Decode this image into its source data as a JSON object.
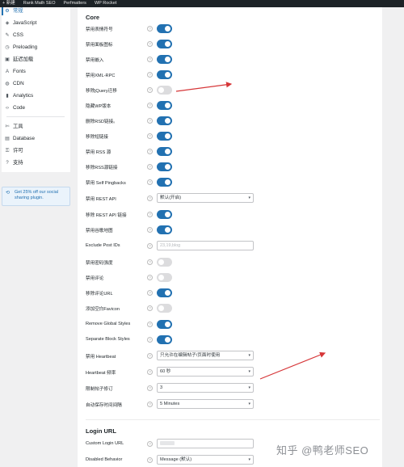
{
  "admin_bar": {
    "items": [
      "+ 新建",
      "Rank Math SEO",
      "Perfmatters",
      "WP Rocket"
    ]
  },
  "sidebar": {
    "items": [
      {
        "label": "常规",
        "icon": "gear-icon",
        "glyph": "⚙",
        "active": true
      },
      {
        "label": "JavaScript",
        "icon": "code-icon",
        "glyph": "◈",
        "active": false
      },
      {
        "label": "CSS",
        "icon": "brush-icon",
        "glyph": "✎",
        "active": false
      },
      {
        "label": "Preloading",
        "icon": "clock-icon",
        "glyph": "◷",
        "active": false
      },
      {
        "label": "延迟加载",
        "icon": "image-icon",
        "glyph": "▣",
        "active": false
      },
      {
        "label": "Fonts",
        "icon": "font-icon",
        "glyph": "A",
        "active": false
      },
      {
        "label": "CDN",
        "icon": "globe-icon",
        "glyph": "◍",
        "active": false
      },
      {
        "label": "Analytics",
        "icon": "chart-icon",
        "glyph": "▮",
        "active": false
      },
      {
        "label": "Code",
        "icon": "brackets-icon",
        "glyph": "‹›",
        "active": false
      },
      {
        "label": "工具",
        "icon": "wrench-icon",
        "glyph": "✄",
        "active": false
      },
      {
        "label": "Database",
        "icon": "database-icon",
        "glyph": "▤",
        "active": false
      },
      {
        "label": "许可",
        "icon": "key-icon",
        "glyph": "⚿",
        "active": false
      },
      {
        "label": "支持",
        "icon": "help-icon",
        "glyph": "?",
        "active": false
      }
    ]
  },
  "promo": {
    "text": "Get 25% off our social sharing plugin.",
    "icon": "share-icon",
    "glyph": "⟲"
  },
  "core": {
    "title": "Core",
    "rows": [
      {
        "label": "禁用表情符号",
        "type": "toggle",
        "on": true
      },
      {
        "label": "禁用面板图标",
        "type": "toggle",
        "on": true
      },
      {
        "label": "禁用嵌入",
        "type": "toggle",
        "on": true
      },
      {
        "label": "禁用XML-RPC",
        "type": "toggle",
        "on": true
      },
      {
        "label": "移除jQuery迁移",
        "type": "toggle",
        "on": false
      },
      {
        "label": "隐藏WP版本",
        "type": "toggle",
        "on": true
      },
      {
        "label": "删除RSD链接。",
        "type": "toggle",
        "on": true
      },
      {
        "label": "移除短链接",
        "type": "toggle",
        "on": true
      },
      {
        "label": "禁用 RSS 源",
        "type": "toggle",
        "on": true
      },
      {
        "label": "移除RSS源链接",
        "type": "toggle",
        "on": true
      },
      {
        "label": "禁用 Self Pingbacks",
        "type": "toggle",
        "on": true
      },
      {
        "label": "禁用 REST API",
        "type": "select",
        "value": "默认(开启)"
      },
      {
        "label": "移除 REST API 链接",
        "type": "toggle",
        "on": true
      },
      {
        "label": "禁用谷歌地图",
        "type": "toggle",
        "on": true
      },
      {
        "label": "Exclude Post IDs",
        "type": "input",
        "placeholder": "23,19,blog"
      },
      {
        "label": "禁用密码强度",
        "type": "toggle",
        "on": false
      },
      {
        "label": "禁用评论",
        "type": "toggle",
        "on": false
      },
      {
        "label": "移除评论URL",
        "type": "toggle",
        "on": true
      },
      {
        "label": "添加空白Favicon",
        "type": "toggle",
        "on": false
      },
      {
        "label": "Remove Global Styles",
        "type": "toggle",
        "on": true
      },
      {
        "label": "Separate Block Styles",
        "type": "toggle",
        "on": true
      },
      {
        "label": "禁用 Heartbeat",
        "type": "select",
        "value": "只允许在编辑帖子/页面时使用"
      },
      {
        "label": "Heartbeat 频率",
        "type": "select",
        "value": "60 秒"
      },
      {
        "label": "限制帖子修订",
        "type": "select",
        "value": "3"
      },
      {
        "label": "自动保存时间间隔",
        "type": "select",
        "value": "5 Minutes"
      }
    ]
  },
  "login": {
    "title": "Login URL",
    "rows": [
      {
        "label": "Custom Login URL",
        "type": "input",
        "placeholder": ""
      },
      {
        "label": "Disabled Behavior",
        "type": "select",
        "value": "Message (默认)"
      }
    ]
  },
  "help_glyph": "?",
  "caret_glyph": "▾",
  "accent_color": "#2271b1",
  "arrow_color": "#d63638",
  "watermark": "知乎 @鸭老师SEO"
}
